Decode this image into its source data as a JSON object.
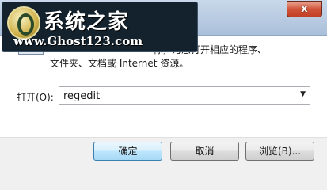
{
  "window": {
    "close_glyph": "x"
  },
  "watermark": {
    "title": "系统之家",
    "url": "www.Ghost123.com"
  },
  "content": {
    "desc_line1": "称，为您打开相应的程序、",
    "desc_line2": "文件夹、文档或 Internet 资源。",
    "open_label": "打开(O):",
    "open_value": "regedit"
  },
  "buttons": {
    "ok": "确定",
    "cancel": "取消",
    "browse": "浏览(B)..."
  },
  "colors": {
    "titlebar": "#b7cae1",
    "close": "#c94a2e",
    "ok_button": "#bee6fd"
  }
}
